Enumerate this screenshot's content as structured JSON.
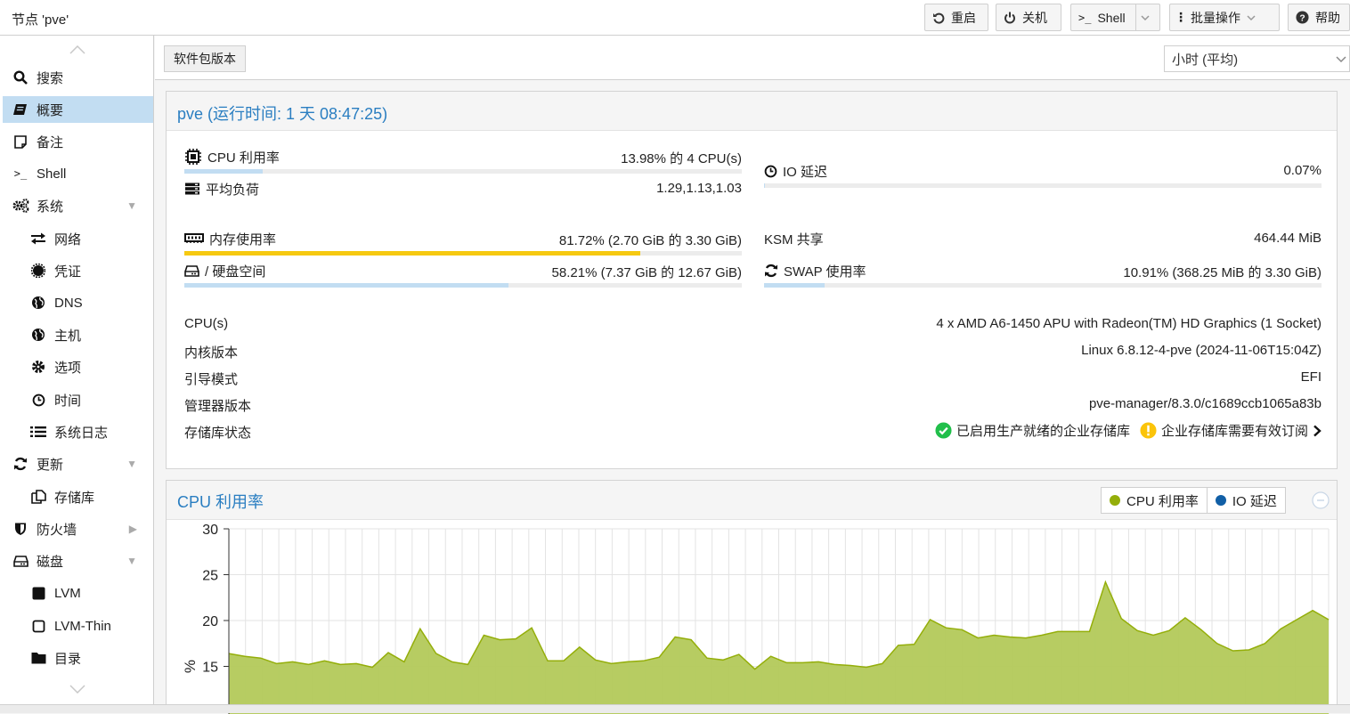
{
  "header": {
    "node_title": "节点 'pve'",
    "buttons": {
      "restart": "重启",
      "shutdown": "关机",
      "shell": "Shell",
      "bulk": "批量操作",
      "help": "帮助"
    }
  },
  "sidebar": {
    "items": [
      {
        "label": "搜索",
        "icon": "search-icon"
      },
      {
        "label": "概要",
        "icon": "book-icon",
        "selected": true
      },
      {
        "label": "备注",
        "icon": "note-icon"
      },
      {
        "label": "Shell",
        "icon": "terminal-icon"
      },
      {
        "label": "系统",
        "icon": "gears-icon",
        "expanded": true
      },
      {
        "label": "网络",
        "icon": "exchange-icon"
      },
      {
        "label": "凭证",
        "icon": "certificate-icon"
      },
      {
        "label": "DNS",
        "icon": "globe-icon"
      },
      {
        "label": "主机",
        "icon": "globe-icon"
      },
      {
        "label": "选项",
        "icon": "gear-icon"
      },
      {
        "label": "时间",
        "icon": "clock-icon"
      },
      {
        "label": "系统日志",
        "icon": "list-icon"
      },
      {
        "label": "更新",
        "icon": "refresh-icon",
        "expanded": true
      },
      {
        "label": "存储库",
        "icon": "files-icon"
      },
      {
        "label": "防火墙",
        "icon": "shield-icon",
        "expanded": false
      },
      {
        "label": "磁盘",
        "icon": "hdd-icon",
        "expanded": true
      },
      {
        "label": "LVM",
        "icon": "square-icon"
      },
      {
        "label": "LVM-Thin",
        "icon": "square-outline-icon"
      },
      {
        "label": "目录",
        "icon": "folder-icon"
      }
    ]
  },
  "toolbar": {
    "package_versions": "软件包版本",
    "timeframe": "小时 (平均)"
  },
  "status": {
    "title": "pve (运行时间: 1 天 08:47:25)",
    "cpu": {
      "label": "CPU 利用率",
      "value": "13.98% 的 4 CPU(s)",
      "percent": 13.98
    },
    "load": {
      "label": "平均负荷",
      "value": "1.29,1.13,1.03"
    },
    "io": {
      "label": "IO 延迟",
      "value": "0.07%",
      "percent": 0.07
    },
    "memory": {
      "label": "内存使用率",
      "value": "81.72% (2.70 GiB 的 3.30 GiB)",
      "percent": 81.72
    },
    "ksm": {
      "label": "KSM 共享",
      "value": "464.44 MiB"
    },
    "disk": {
      "label": "/ 硬盘空间",
      "value": "58.21% (7.37 GiB 的 12.67 GiB)",
      "percent": 58.21
    },
    "swap": {
      "label": "SWAP 使用率",
      "value": "10.91% (368.25 MiB 的 3.30 GiB)",
      "percent": 10.91
    },
    "info": [
      {
        "label": "CPU(s)",
        "value": "4 x AMD A6-1450 APU with Radeon(TM) HD Graphics (1 Socket)"
      },
      {
        "label": "内核版本",
        "value": "Linux 6.8.12-4-pve (2024-11-06T15:04Z)"
      },
      {
        "label": "引导模式",
        "value": "EFI"
      },
      {
        "label": "管理器版本",
        "value": "pve-manager/8.3.0/c1689ccb1065a83b"
      }
    ],
    "repo": {
      "label": "存储库状态",
      "ok_text": "已启用生产就绪的企业存储库",
      "warn_text": "企业存储库需要有效订阅"
    }
  },
  "colors": {
    "accent": "#2a7ec1",
    "selected": "#c2ddf2",
    "memory_bar": "#f6c911",
    "cpu_series": "#94ae0a",
    "io_series": "#115fa6",
    "ok": "#21bf4b",
    "warn": "#fbc40a"
  },
  "chart_data": {
    "type": "area",
    "title": "CPU 利用率",
    "ylabel": "%",
    "ylim": [
      13,
      30
    ],
    "yticks": [
      "30",
      "25",
      "20",
      "15"
    ],
    "legend": [
      "CPU 利用率",
      "IO 延迟"
    ],
    "series": [
      {
        "name": "CPU 利用率",
        "values": [
          16.4,
          16.1,
          15.9,
          15.3,
          15.5,
          15.2,
          15.6,
          15.2,
          15.3,
          14.9,
          16.5,
          15.5,
          19.1,
          16.4,
          15.5,
          15.2,
          18.4,
          17.9,
          18.0,
          19.2,
          15.6,
          15.6,
          17.1,
          15.7,
          15.3,
          15.5,
          15.6,
          16.0,
          18.2,
          17.9,
          15.9,
          15.7,
          16.3,
          14.7,
          16.1,
          15.4,
          15.4,
          15.5,
          15.2,
          15.1,
          14.9,
          15.3,
          17.3,
          17.4,
          20.1,
          19.2,
          19.0,
          18.1,
          18.4,
          18.2,
          18.1,
          18.4,
          18.8,
          18.8,
          18.8,
          24.2,
          20.2,
          18.9,
          18.4,
          18.9,
          20.3,
          19.0,
          17.5,
          16.7,
          16.8,
          17.5,
          19.1,
          20.1,
          21.1,
          20.1
        ]
      },
      {
        "name": "IO 延迟",
        "values": []
      }
    ]
  }
}
